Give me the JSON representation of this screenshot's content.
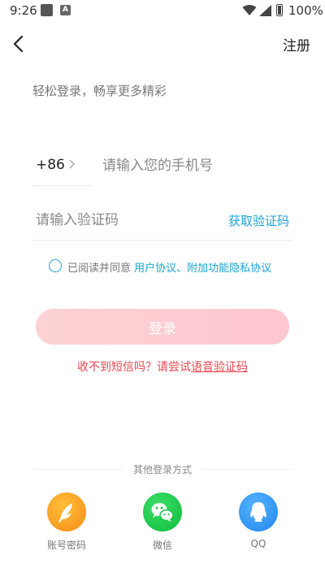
{
  "status_bar": {
    "time": "9:26",
    "battery": "100%"
  },
  "nav": {
    "register_label": "注册"
  },
  "subtitle": "轻松登录，畅享更多精彩",
  "phone": {
    "country_code": "+86",
    "placeholder": "请输入您的手机号"
  },
  "code": {
    "placeholder": "请输入验证码",
    "get_code_label": "获取验证码"
  },
  "agreement": {
    "prefix": "已阅读并同意",
    "links": "用户协议、附加功能隐私协议"
  },
  "login_button": "登录",
  "sms_hint": {
    "prefix": "收不到短信吗？请尝试",
    "link": "语音验证码"
  },
  "other_login": {
    "title": "其他登录方式",
    "options": [
      {
        "label": "账号密码",
        "icon": "feather-icon",
        "color": "#f7951e"
      },
      {
        "label": "微信",
        "icon": "wechat-icon",
        "color": "#15c244"
      },
      {
        "label": "QQ",
        "icon": "qq-icon",
        "color": "#2b8ff0"
      }
    ]
  },
  "colors": {
    "accent": "#1aa3d6",
    "warning": "#e8474f",
    "login_button": "#fcd2d4"
  }
}
